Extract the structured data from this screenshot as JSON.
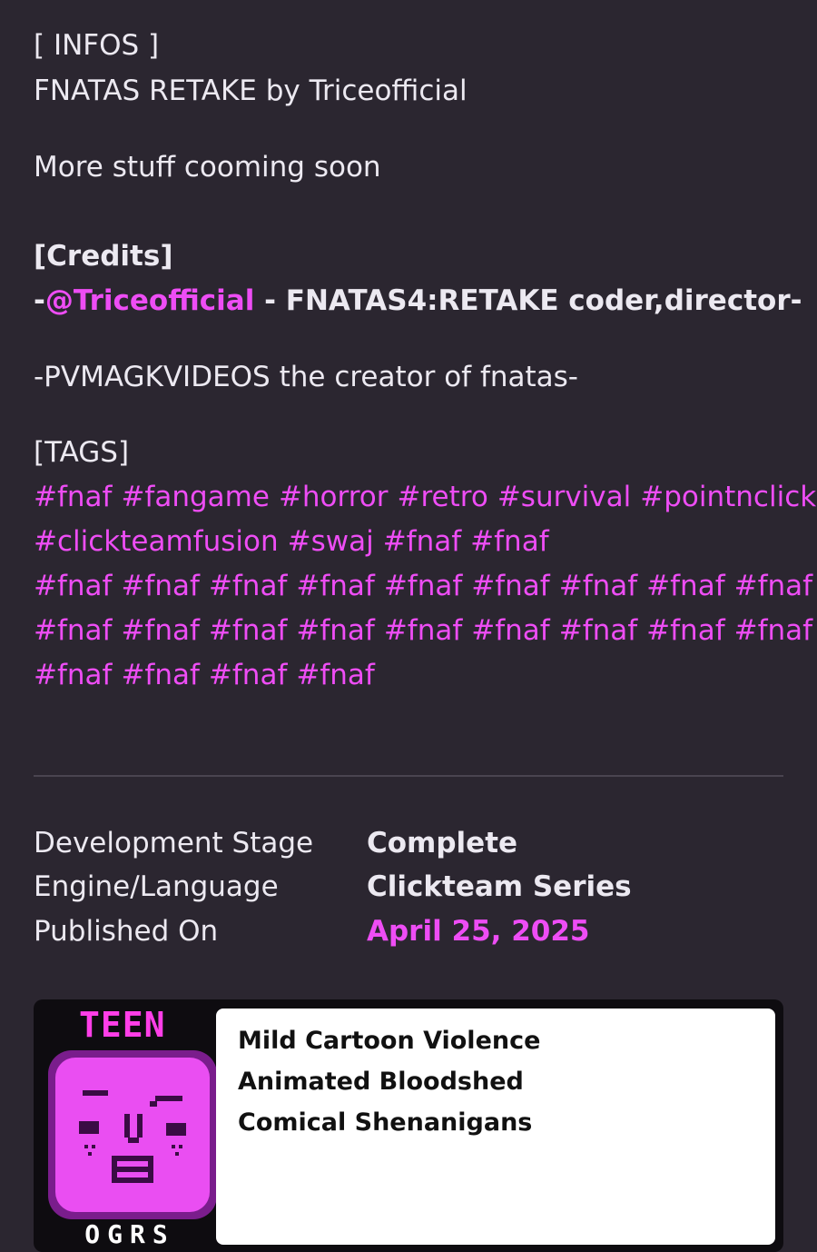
{
  "infos": {
    "heading": "[ INFOS ]",
    "title": "FNATAS RETAKE by Triceofficial",
    "note": "More stuff cooming soon"
  },
  "credits": {
    "heading": "[Credits]",
    "line1_prefix": "-",
    "line1_handle": "@Triceofficial",
    "line1_suffix": " - FNATAS4:RETAKE coder,director-",
    "line2": "-PVMAGKVIDEOS the creator of fnatas-"
  },
  "tags": {
    "heading": "[TAGS]",
    "rows": [
      [
        " #fnaf",
        "#fangame",
        "#horror",
        "#retro",
        "#survival",
        "#pointnclick"
      ],
      [
        " #clickteamfusion",
        "#swaj",
        "#fnaf",
        "#fnaf"
      ],
      [
        "#fnaf",
        "#fnaf",
        "#fnaf",
        "#fnaf",
        "#fnaf",
        "#fnaf",
        "#fnaf",
        "#fnaf",
        "#fnaf"
      ],
      [
        "#fnaf",
        "#fnaf",
        "#fnaf",
        "#fnaf",
        "#fnaf",
        "#fnaf",
        "#fnaf",
        "#fnaf",
        "#fnaf"
      ],
      [
        "#fnaf",
        "#fnaf",
        "#fnaf",
        "#fnaf"
      ]
    ]
  },
  "meta": {
    "stage_label": "Development Stage",
    "stage_value": "Complete",
    "engine_label": "Engine/Language",
    "engine_value": "Clickteam Series",
    "published_label": "Published On",
    "published_value": "April 25, 2025"
  },
  "rating": {
    "level": "TEEN",
    "system": "OGRS",
    "descriptors": [
      "Mild Cartoon Violence",
      "Animated Bloodshed",
      "Comical Shenanigans"
    ]
  },
  "colors": {
    "background": "#2b2630",
    "text": "#ece9f1",
    "accent": "#ee4df5"
  }
}
